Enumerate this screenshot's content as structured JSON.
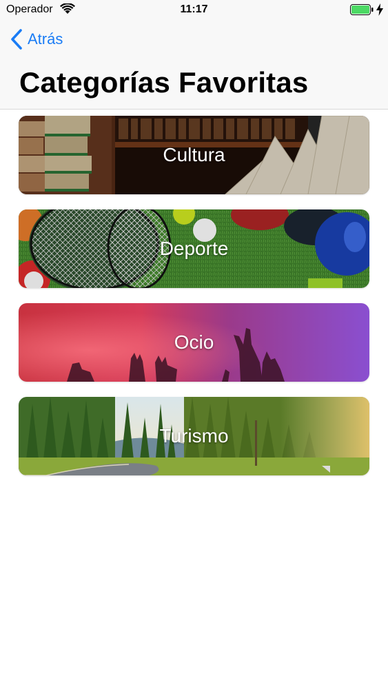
{
  "status_bar": {
    "carrier": "Operador",
    "time": "11:17",
    "battery_color": "#4cd964"
  },
  "nav": {
    "back_label": "Atrás",
    "title": "Categorías Favoritas",
    "accent_color": "#1a7cf5"
  },
  "categories": [
    {
      "label": "Cultura",
      "image": "books-image"
    },
    {
      "label": "Deporte",
      "image": "sports-equipment-image"
    },
    {
      "label": "Ocio",
      "image": "concert-crowd-image"
    },
    {
      "label": "Turismo",
      "image": "forest-road-image"
    }
  ]
}
